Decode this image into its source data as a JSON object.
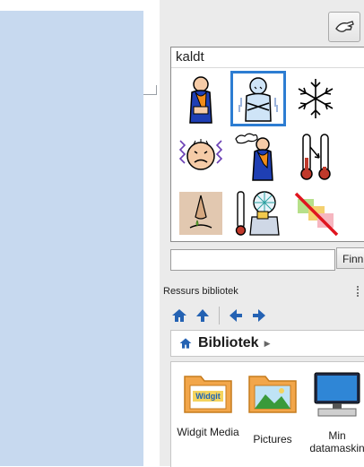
{
  "symbol_panel": {
    "title": "kaldt",
    "symbols": [
      {
        "icon": "person-cold-icon"
      },
      {
        "icon": "person-freezing-icon",
        "selected": true
      },
      {
        "icon": "snowflake-icon"
      },
      {
        "icon": "shivering-face-icon"
      },
      {
        "icon": "person-cold-breath-icon"
      },
      {
        "icon": "thermometers-icon"
      },
      {
        "icon": "nose-drip-icon"
      },
      {
        "icon": "thermometer-fan-icon"
      },
      {
        "icon": "no-color-icon"
      }
    ]
  },
  "search": {
    "value": "",
    "button_label": "Finn"
  },
  "resources": {
    "header": "Ressurs bibliotek",
    "breadcrumb": "Bibliotek",
    "items": [
      {
        "label": "Widgit Media",
        "icon": "widgit-folder-icon",
        "folder_badge": "Widgit"
      },
      {
        "label": "Pictures",
        "icon": "pictures-folder-icon"
      },
      {
        "label": "Min datamaskin",
        "icon": "computer-icon"
      }
    ]
  },
  "colors": {
    "accent": "#2d7dd2",
    "folder": "#f2a64a",
    "left_strip": "#c7d9ef"
  }
}
